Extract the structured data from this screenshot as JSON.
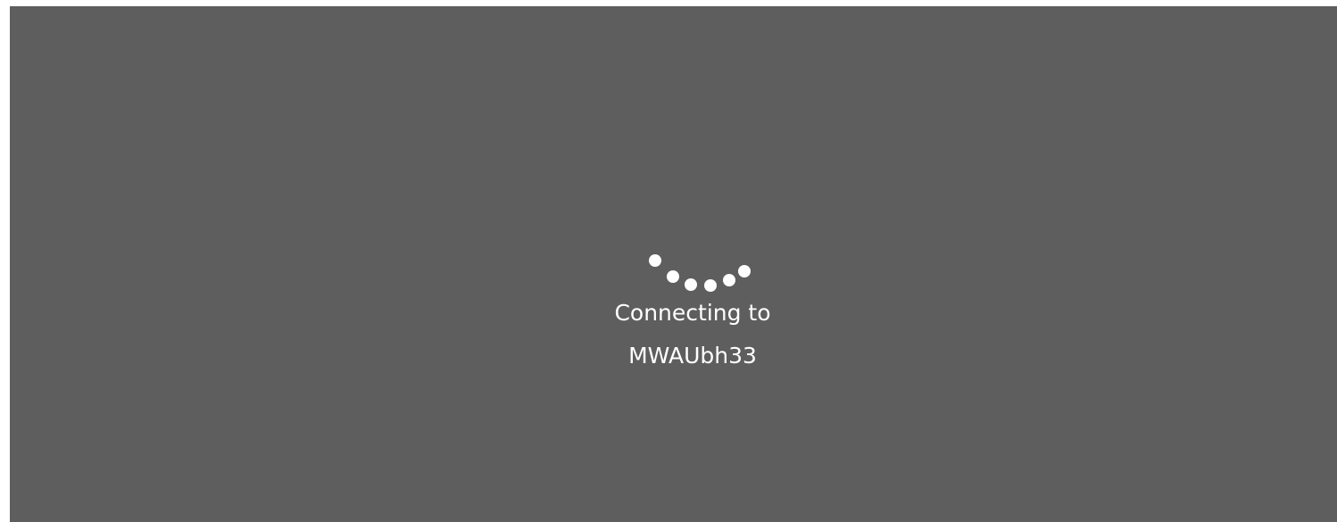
{
  "connection": {
    "status_line": "Connecting to",
    "target_name": "MWAUbh33"
  },
  "colors": {
    "background": "#5e5e5e",
    "text": "#ffffff",
    "spinner": "#ffffff"
  },
  "icons": {
    "spinner": "loading-spinner-icon"
  }
}
